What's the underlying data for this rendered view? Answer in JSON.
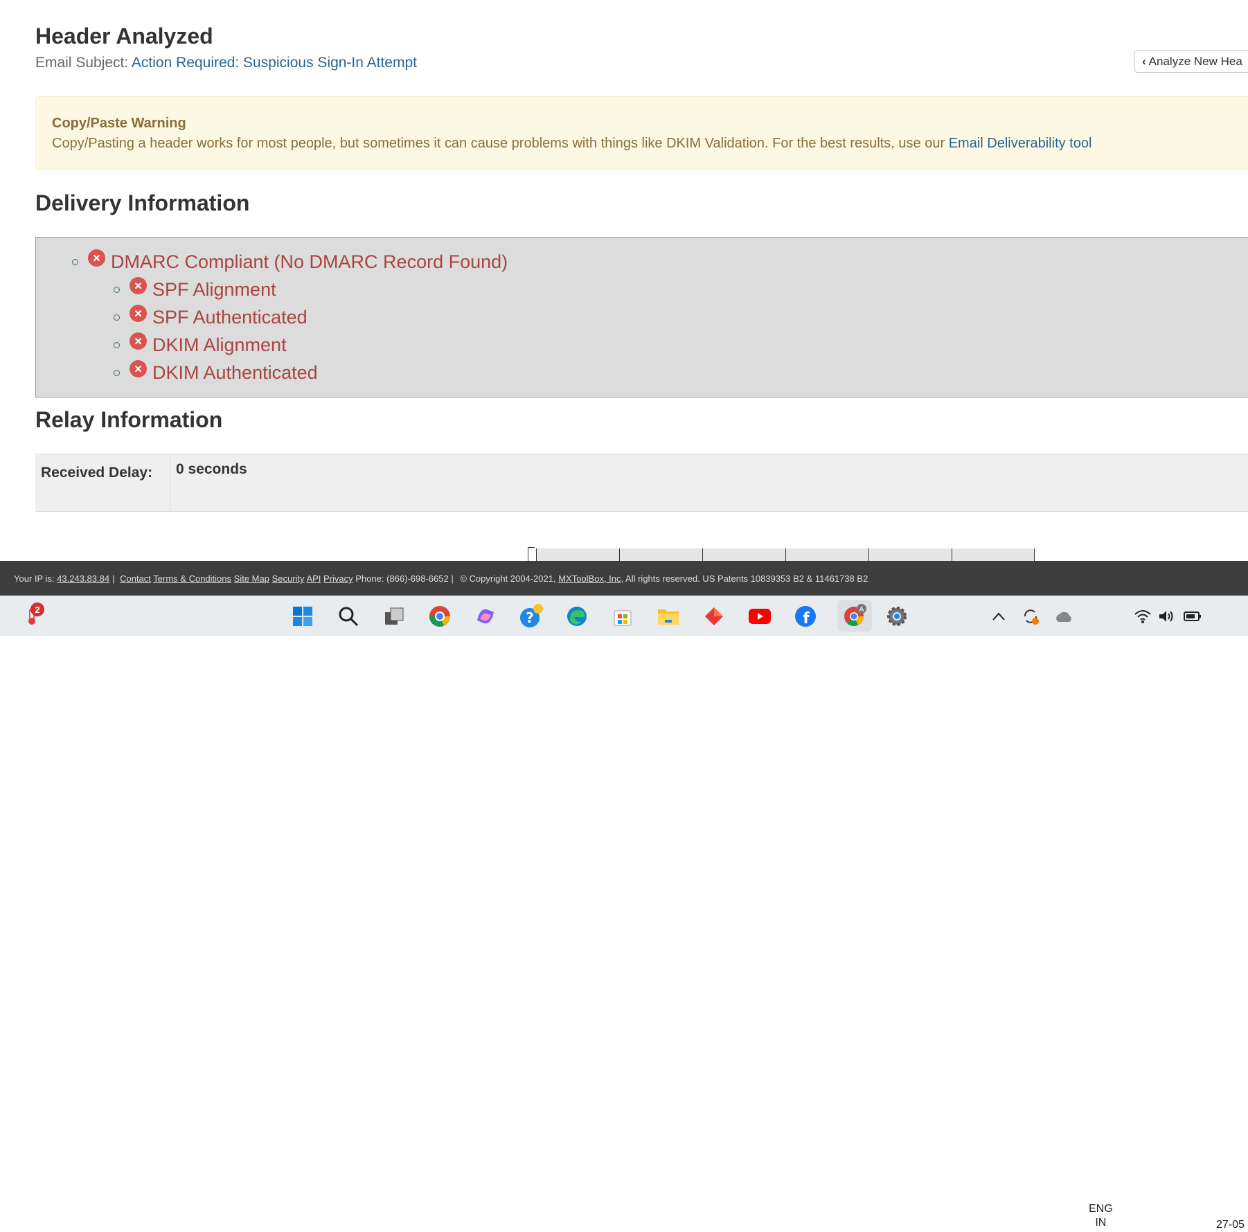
{
  "header": {
    "title": "Header Analyzed",
    "subject_label": "Email Subject:",
    "subject_value": "Action Required: Suspicious Sign-In Attempt",
    "analyze_button": "Analyze New Hea"
  },
  "warning": {
    "title": "Copy/Paste Warning",
    "text": "Copy/Pasting a header works for most people, but sometimes it can cause problems with things like DKIM Validation. For the best results, use our ",
    "link": "Email Deliverability tool"
  },
  "delivery": {
    "title": "Delivery Information",
    "items": [
      {
        "label": "DMARC Compliant (No DMARC Record Found)",
        "level": 0,
        "status": "fail"
      },
      {
        "label": "SPF Alignment",
        "level": 1,
        "status": "fail"
      },
      {
        "label": "SPF Authenticated",
        "level": 1,
        "status": "fail"
      },
      {
        "label": "DKIM Alignment",
        "level": 1,
        "status": "fail"
      },
      {
        "label": "DKIM Authenticated",
        "level": 1,
        "status": "fail"
      }
    ]
  },
  "relay": {
    "title": "Relay Information",
    "key": "Received Delay:",
    "value": "0 seconds"
  },
  "footer": {
    "ip_label": "Your IP is:",
    "ip": "43.243.83.84",
    "links": [
      "Contact",
      "Terms & Conditions",
      "Site Map",
      "Security",
      "API",
      "Privacy"
    ],
    "phone": "Phone: (866)-698-6652 |",
    "copyright_prefix": "© Copyright 2004-2021,",
    "company": "MXToolBox, Inc",
    "copyright_suffix": ", All rights reserved. US Patents 10839353 B2 & 11461738 B2"
  },
  "taskbar": {
    "notification_count": "2",
    "language_line1": "ENG",
    "language_line2": "IN",
    "date_partial": "27-05",
    "icons": [
      "weather-icon",
      "windows-start-icon",
      "search-icon",
      "task-view-icon",
      "chrome-icon",
      "copilot-icon",
      "help-icon",
      "edge-icon",
      "store-icon",
      "file-explorer-icon",
      "app-diamond-icon",
      "youtube-icon",
      "facebook-icon",
      "chrome-profile-icon",
      "settings-icon"
    ]
  },
  "colors": {
    "fail_red": "#a94442",
    "fail_icon": "#d9534f",
    "link_blue": "#2a6496",
    "warning_bg": "#fcf8e3",
    "footer_bg": "#3e3e3e"
  }
}
